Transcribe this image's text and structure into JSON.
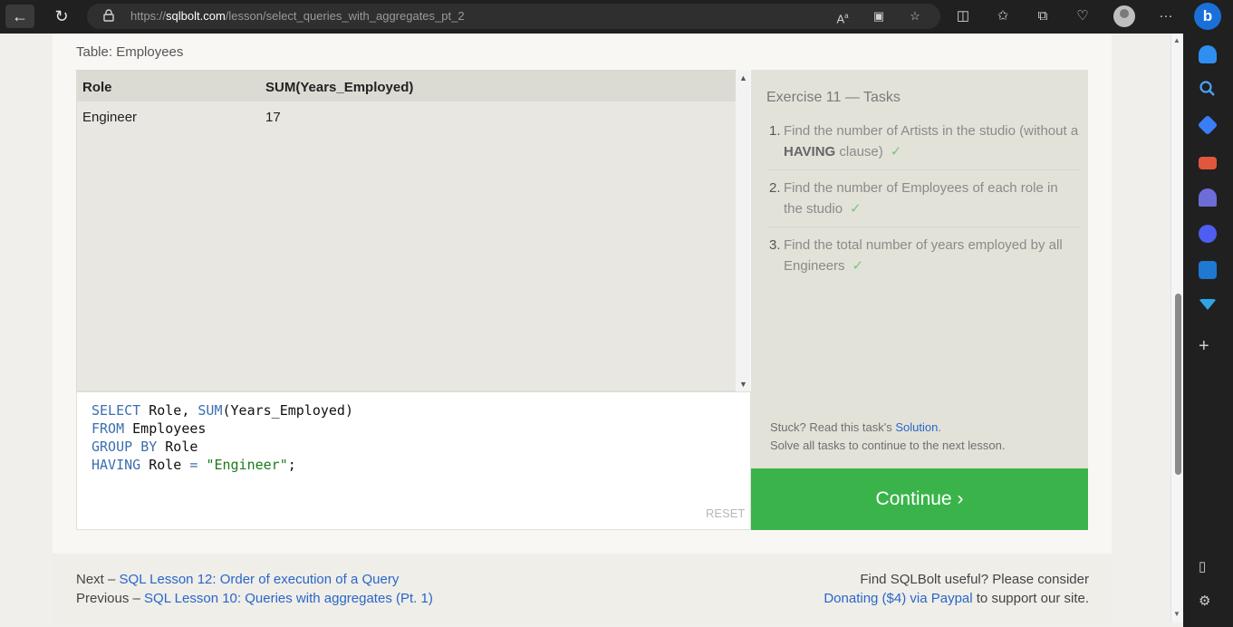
{
  "browser": {
    "url_prefix": "https://",
    "url_domain": "sqlbolt.com",
    "url_path": "/lesson/select_queries_with_aggregates_pt_2",
    "icons": [
      "back-icon",
      "reload-icon",
      "lock-icon",
      "read-aloud-icon",
      "immersive-reader-icon",
      "favorite-star-icon",
      "split-screen-icon",
      "favorites-icon",
      "collections-icon",
      "browser-essentials-icon",
      "profile-icon",
      "more-icon",
      "bing-copilot-icon"
    ],
    "accent": "#1b6fd8"
  },
  "sidebar": {
    "icons": [
      "notifications-icon",
      "search-icon",
      "shopping-tag-icon",
      "tools-icon",
      "games-icon",
      "copilot-icon",
      "outlook-icon",
      "telegram-icon",
      "add-icon",
      "sidebar-toggle-icon",
      "settings-icon"
    ]
  },
  "lesson": {
    "table_label": "Table: Employees",
    "result_headers": [
      "Role",
      "SUM(Years_Employed)"
    ],
    "result_rows": [
      [
        "Engineer",
        "17"
      ]
    ],
    "query": {
      "line1_kw": "SELECT",
      "line1_rest": " Role, ",
      "line1_fn": "SUM",
      "line1_end": "(Years_Employed)",
      "line2_kw": "FROM",
      "line2_rest": " Employees",
      "line3_kw1": "GROUP",
      "line3_kw2": "BY",
      "line3_rest": " Role",
      "line4_kw": "HAVING",
      "line4_rest": " Role ",
      "line4_op": "=",
      "line4_str": "\"Engineer\"",
      "line4_end": ";"
    },
    "reset_label": "RESET"
  },
  "tasks": {
    "title": "Exercise 11 — Tasks",
    "items": [
      {
        "num": "1.",
        "text_a": "Find the number of Artists in the studio (without a ",
        "bold": "HAVING",
        "text_b": " clause)",
        "check": "✓"
      },
      {
        "num": "2.",
        "text_a": "Find the number of Employees of each role in the studio",
        "bold": "",
        "text_b": "",
        "check": "✓"
      },
      {
        "num": "3.",
        "text_a": "Find the total number of years employed by all Engineers",
        "bold": "",
        "text_b": "",
        "check": "✓"
      }
    ],
    "hint_pre": "Stuck? Read this task's ",
    "hint_link": "Solution",
    "hint_post": ".",
    "hint_line2": "Solve all tasks to continue to the next lesson.",
    "continue_label": "Continue ›",
    "continue_color": "#3ab44a"
  },
  "footer": {
    "next_prefix": "Next – ",
    "next_link": "SQL Lesson 12: Order of execution of a Query",
    "prev_prefix": "Previous – ",
    "prev_link": "SQL Lesson 10: Queries with aggregates (Pt. 1)",
    "useful_text": "Find SQLBolt useful? Please consider",
    "donate_link": "Donating ($4) via Paypal",
    "donate_post": " to support our site."
  }
}
